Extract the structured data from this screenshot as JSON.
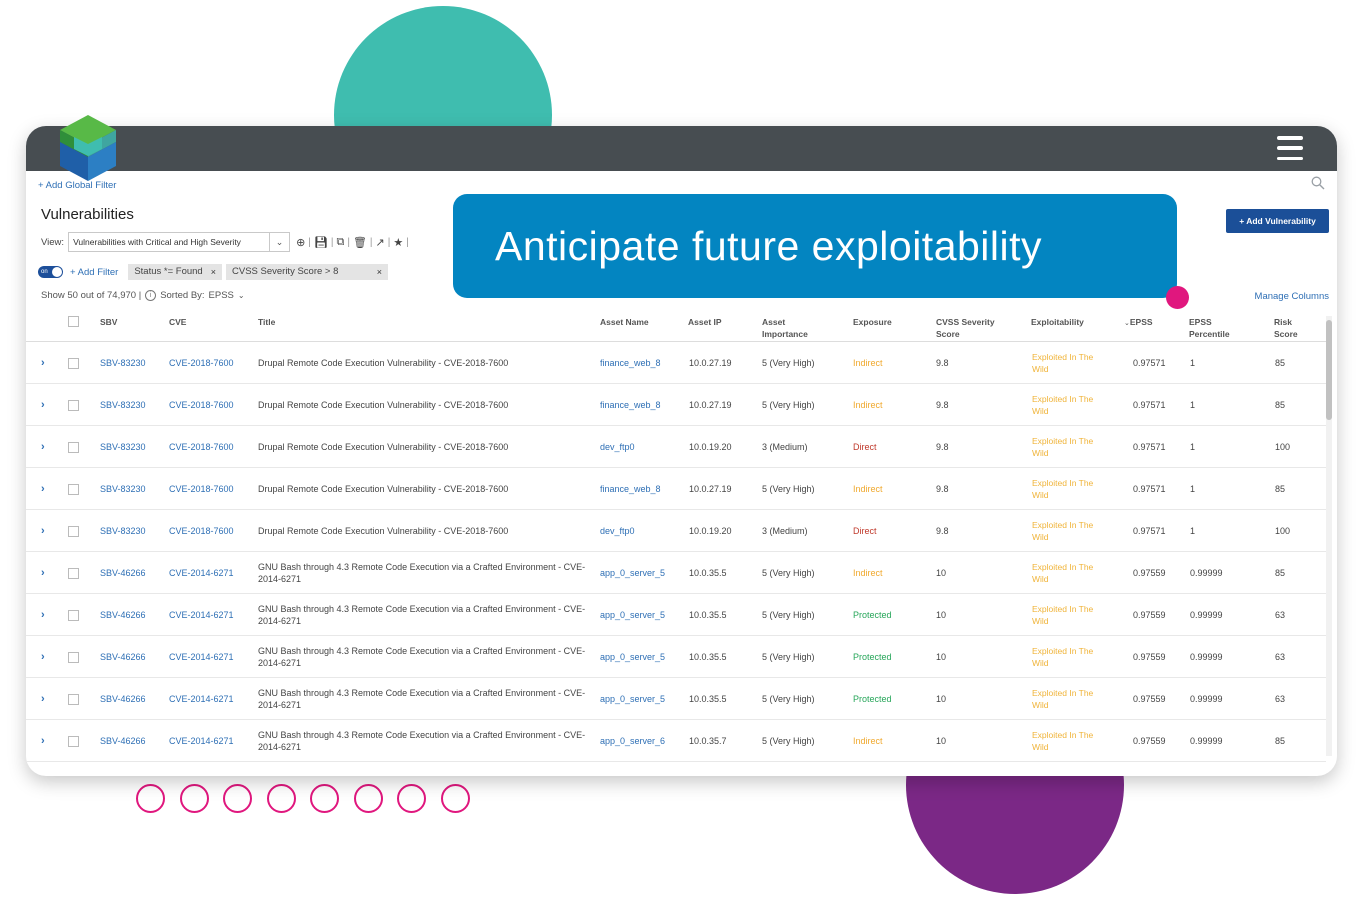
{
  "banner": {
    "text": "Anticipate future exploitability"
  },
  "header": {
    "global_filter": "+ Add Global Filter"
  },
  "page": {
    "title": "Vulnerabilities",
    "view_label": "View:",
    "view_value": "Vulnerabilities with Critical and High Severity",
    "add_vuln": "+ Add Vulnerability"
  },
  "filters": {
    "toggle": "on",
    "add_filter": "+ Add Filter",
    "chips": [
      {
        "label": "Status *= Found"
      },
      {
        "label": "CVSS Severity Score > 8"
      }
    ]
  },
  "summary": {
    "show": "Show 50 out of 74,970 |",
    "sorted_label": "Sorted By:",
    "sorted_value": "EPSS",
    "manage_columns": "Manage Columns"
  },
  "columns": {
    "sbv": "SBV",
    "cve": "CVE",
    "title": "Title",
    "asset_name": "Asset Name",
    "asset_ip": "Asset IP",
    "asset_importance": "Asset Importance",
    "exposure": "Exposure",
    "cvss": "CVSS Severity Score",
    "exploitability": "Exploitability",
    "epss": "EPSS",
    "epss_percentile": "EPSS Percentile",
    "risk": "Risk Score"
  },
  "rows": [
    {
      "sbv": "SBV-83230",
      "cve": "CVE-2018-7600",
      "title": "Drupal Remote Code Execution Vulnerability - CVE-2018-7600",
      "asset_name": "finance_web_8",
      "asset_ip": "10.0.27.19",
      "importance": "5 (Very High)",
      "exposure": "Indirect",
      "cvss": "9.8",
      "exploit": "Exploited In The Wild",
      "epss": "0.97571",
      "pct": "1",
      "risk": "85"
    },
    {
      "sbv": "SBV-83230",
      "cve": "CVE-2018-7600",
      "title": "Drupal Remote Code Execution Vulnerability - CVE-2018-7600",
      "asset_name": "finance_web_8",
      "asset_ip": "10.0.27.19",
      "importance": "5 (Very High)",
      "exposure": "Indirect",
      "cvss": "9.8",
      "exploit": "Exploited In The Wild",
      "epss": "0.97571",
      "pct": "1",
      "risk": "85"
    },
    {
      "sbv": "SBV-83230",
      "cve": "CVE-2018-7600",
      "title": "Drupal Remote Code Execution Vulnerability - CVE-2018-7600",
      "asset_name": "dev_ftp0",
      "asset_ip": "10.0.19.20",
      "importance": "3 (Medium)",
      "exposure": "Direct",
      "cvss": "9.8",
      "exploit": "Exploited In The Wild",
      "epss": "0.97571",
      "pct": "1",
      "risk": "100"
    },
    {
      "sbv": "SBV-83230",
      "cve": "CVE-2018-7600",
      "title": "Drupal Remote Code Execution Vulnerability - CVE-2018-7600",
      "asset_name": "finance_web_8",
      "asset_ip": "10.0.27.19",
      "importance": "5 (Very High)",
      "exposure": "Indirect",
      "cvss": "9.8",
      "exploit": "Exploited In The Wild",
      "epss": "0.97571",
      "pct": "1",
      "risk": "85"
    },
    {
      "sbv": "SBV-83230",
      "cve": "CVE-2018-7600",
      "title": "Drupal Remote Code Execution Vulnerability - CVE-2018-7600",
      "asset_name": "dev_ftp0",
      "asset_ip": "10.0.19.20",
      "importance": "3 (Medium)",
      "exposure": "Direct",
      "cvss": "9.8",
      "exploit": "Exploited In The Wild",
      "epss": "0.97571",
      "pct": "1",
      "risk": "100"
    },
    {
      "sbv": "SBV-46266",
      "cve": "CVE-2014-6271",
      "title": "GNU Bash through 4.3 Remote Code Execution via a Crafted Environment - CVE-2014-6271",
      "asset_name": "app_0_server_5",
      "asset_ip": "10.0.35.5",
      "importance": "5 (Very High)",
      "exposure": "Indirect",
      "cvss": "10",
      "exploit": "Exploited In The Wild",
      "epss": "0.97559",
      "pct": "0.99999",
      "risk": "85"
    },
    {
      "sbv": "SBV-46266",
      "cve": "CVE-2014-6271",
      "title": "GNU Bash through 4.3 Remote Code Execution via a Crafted Environment - CVE-2014-6271",
      "asset_name": "app_0_server_5",
      "asset_ip": "10.0.35.5",
      "importance": "5 (Very High)",
      "exposure": "Protected",
      "cvss": "10",
      "exploit": "Exploited In The Wild",
      "epss": "0.97559",
      "pct": "0.99999",
      "risk": "63"
    },
    {
      "sbv": "SBV-46266",
      "cve": "CVE-2014-6271",
      "title": "GNU Bash through 4.3 Remote Code Execution via a Crafted Environment - CVE-2014-6271",
      "asset_name": "app_0_server_5",
      "asset_ip": "10.0.35.5",
      "importance": "5 (Very High)",
      "exposure": "Protected",
      "cvss": "10",
      "exploit": "Exploited In The Wild",
      "epss": "0.97559",
      "pct": "0.99999",
      "risk": "63"
    },
    {
      "sbv": "SBV-46266",
      "cve": "CVE-2014-6271",
      "title": "GNU Bash through 4.3 Remote Code Execution via a Crafted Environment - CVE-2014-6271",
      "asset_name": "app_0_server_5",
      "asset_ip": "10.0.35.5",
      "importance": "5 (Very High)",
      "exposure": "Protected",
      "cvss": "10",
      "exploit": "Exploited In The Wild",
      "epss": "0.97559",
      "pct": "0.99999",
      "risk": "63"
    },
    {
      "sbv": "SBV-46266",
      "cve": "CVE-2014-6271",
      "title": "GNU Bash through 4.3 Remote Code Execution via a Crafted Environment - CVE-2014-6271",
      "asset_name": "app_0_server_6",
      "asset_ip": "10.0.35.7",
      "importance": "5 (Very High)",
      "exposure": "Indirect",
      "cvss": "10",
      "exploit": "Exploited In The Wild",
      "epss": "0.97559",
      "pct": "0.99999",
      "risk": "85"
    }
  ],
  "colors": {
    "teal": "#3fbdaf",
    "purple": "#7b2886",
    "pink": "#e0177e",
    "banner": "#0385c1",
    "topbar": "#474d51",
    "link": "#2e6fb5"
  },
  "icons": [
    "logo-icon",
    "hamburger-menu-icon",
    "search-icon",
    "add-circle-icon",
    "save-icon",
    "copy-icon",
    "trash-icon",
    "share-icon",
    "star-icon",
    "info-icon",
    "chevron-right-icon",
    "checkbox-icon"
  ]
}
